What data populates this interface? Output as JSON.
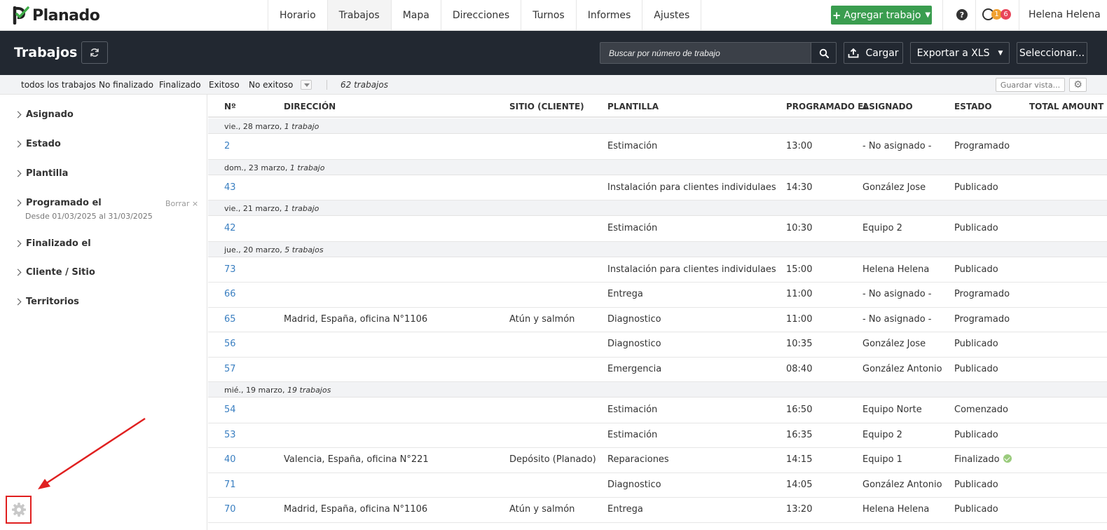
{
  "app": {
    "name": "Planado"
  },
  "nav": {
    "tabs": [
      "Horario",
      "Trabajos",
      "Mapa",
      "Direcciones",
      "Turnos",
      "Informes",
      "Ajustes"
    ],
    "active": "Trabajos",
    "add_button": "Agregar trabajo",
    "help": "?",
    "badge_orange": "1",
    "badge_red": "6",
    "user": "Helena Helena"
  },
  "header": {
    "title": "Trabajos",
    "search_placeholder": "Buscar por número de trabajo",
    "upload": "Cargar",
    "export": "Exportar a XLS",
    "select": "Seleccionar..."
  },
  "filters": {
    "tabs": [
      "todos los trabajos",
      "No finalizado",
      "Finalizado",
      "Exitoso",
      "No exitoso"
    ],
    "count": "62 trabajos",
    "save_view": "Guardar vista..."
  },
  "sidebar": {
    "items": [
      "Asignado",
      "Estado",
      "Plantilla",
      "Programado el",
      "Finalizado el",
      "Cliente / Sitio",
      "Territorios"
    ],
    "programado_sub": "Desde 01/03/2025 al 31/03/2025",
    "clear": "Borrar ×"
  },
  "table": {
    "headers": [
      "Nº",
      "DIRECCIÓN",
      "SITIO (CLIENTE)",
      "PLANTILLA",
      "PROGRAMADO EL",
      "ASIGNADO",
      "ESTADO",
      "TOTAL AMOUNT"
    ],
    "groups": [
      {
        "date": "vie., 28 marzo,",
        "count": "1 trabajo",
        "rows": [
          {
            "num": "2",
            "dir": "",
            "sitio": "",
            "plantilla": "Estimación",
            "hora": "13:00",
            "asignado": "- No asignado -",
            "estado": "Programado"
          }
        ]
      },
      {
        "date": "dom., 23 marzo,",
        "count": "1 trabajo",
        "rows": [
          {
            "num": "43",
            "dir": "",
            "sitio": "",
            "plantilla": "Instalación para clientes individulaes",
            "hora": "14:30",
            "asignado": "González Jose",
            "estado": "Publicado"
          }
        ]
      },
      {
        "date": "vie., 21 marzo,",
        "count": "1 trabajo",
        "rows": [
          {
            "num": "42",
            "dir": "",
            "sitio": "",
            "plantilla": "Estimación",
            "hora": "10:30",
            "asignado": "Equipo 2",
            "estado": "Publicado"
          }
        ]
      },
      {
        "date": "jue., 20 marzo,",
        "count": "5 trabajos",
        "rows": [
          {
            "num": "73",
            "dir": "",
            "sitio": "",
            "plantilla": "Instalación para clientes individulaes",
            "hora": "15:00",
            "asignado": "Helena Helena",
            "estado": "Publicado"
          },
          {
            "num": "66",
            "dir": "",
            "sitio": "",
            "plantilla": "Entrega",
            "hora": "11:00",
            "asignado": "- No asignado -",
            "estado": "Programado"
          },
          {
            "num": "65",
            "dir": "Madrid, España, oficina N°1106",
            "sitio": "Atún y salmón",
            "plantilla": "Diagnostico",
            "hora": "11:00",
            "asignado": "- No asignado -",
            "estado": "Programado"
          },
          {
            "num": "56",
            "dir": "",
            "sitio": "",
            "plantilla": "Diagnostico",
            "hora": "10:35",
            "asignado": "González Jose",
            "estado": "Publicado"
          },
          {
            "num": "57",
            "dir": "",
            "sitio": "",
            "plantilla": "Emergencia",
            "hora": "08:40",
            "asignado": "González Antonio",
            "estado": "Publicado"
          }
        ]
      },
      {
        "date": "mié., 19 marzo,",
        "count": "19 trabajos",
        "rows": [
          {
            "num": "54",
            "dir": "",
            "sitio": "",
            "plantilla": "Estimación",
            "hora": "16:50",
            "asignado": "Equipo Norte",
            "estado": "Comenzado"
          },
          {
            "num": "53",
            "dir": "",
            "sitio": "",
            "plantilla": "Estimación",
            "hora": "16:35",
            "asignado": "Equipo 2",
            "estado": "Publicado"
          },
          {
            "num": "40",
            "dir": "Valencia, España, oficina N°221",
            "sitio": "Depósito (Planado)",
            "plantilla": "Reparaciones",
            "hora": "14:15",
            "asignado": "Equipo 1",
            "estado": "Finalizado",
            "done": true
          },
          {
            "num": "71",
            "dir": "",
            "sitio": "",
            "plantilla": "Diagnostico",
            "hora": "14:05",
            "asignado": "González Antonio",
            "estado": "Publicado"
          },
          {
            "num": "70",
            "dir": "Madrid, España, oficina N°1106",
            "sitio": "Atún y salmón",
            "plantilla": "Entrega",
            "hora": "13:20",
            "asignado": "Helena Helena",
            "estado": "Publicado"
          }
        ]
      }
    ]
  },
  "colors": {
    "accent_green": "#3a9d4f",
    "link_blue": "#3a7fc1",
    "dark_header": "#222831",
    "highlight_red": "#e02020"
  }
}
